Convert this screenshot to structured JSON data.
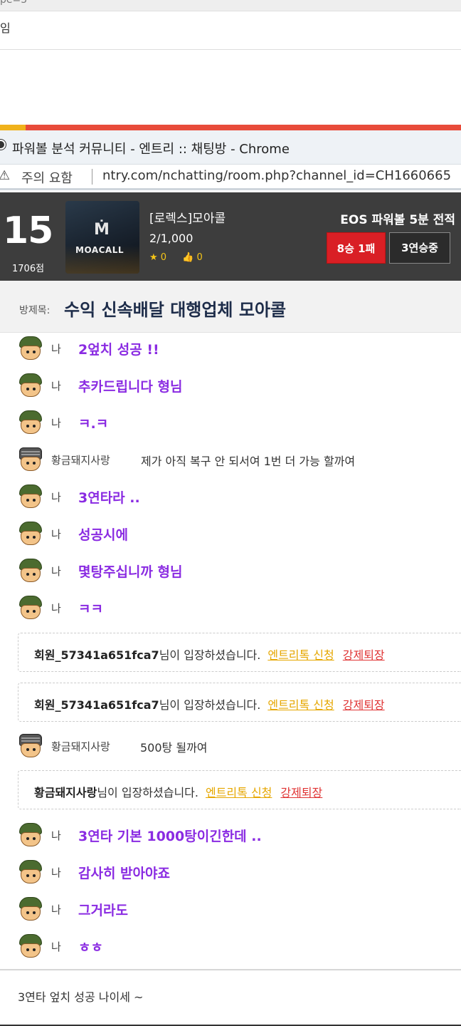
{
  "background_page": {
    "top_text": "pe=5",
    "line_text": "임"
  },
  "window": {
    "title": "파워볼 분석 커뮤니티 - 엔트리 :: 채팅방 - Chrome",
    "warning_label": "주의 요함",
    "url": "ntry.com/nchatting/room.php?channel_id=CH1660665"
  },
  "header": {
    "level": "15",
    "points": "1706점",
    "thumbnail_brand": "MOACALL",
    "room_name": "[로렉스]모아콜",
    "members": "2/1,000",
    "star_count": "0",
    "like_count": "0",
    "record_title": "EOS 파워볼 5분 전적",
    "win_loss": "8승 1패",
    "streak": "3연승중"
  },
  "room": {
    "title_label": "방제목:",
    "title": "수익 신속배달 대행업체 모아콜"
  },
  "messages": [
    {
      "type": "me",
      "nick": "나",
      "text": "2엎치 성공 !!"
    },
    {
      "type": "me",
      "nick": "나",
      "text": "추카드립니다 형님"
    },
    {
      "type": "me",
      "nick": "나",
      "text": "ㅋ.ㅋ"
    },
    {
      "type": "other",
      "nick": "황금돼지사랑",
      "text": "제가 아직 복구 안 되서여 1번 더 가능 할까여"
    },
    {
      "type": "me",
      "nick": "나",
      "text": "3연타라 .."
    },
    {
      "type": "me",
      "nick": "나",
      "text": "성공시에"
    },
    {
      "type": "me",
      "nick": "나",
      "text": "몇탕주십니까 형님"
    },
    {
      "type": "me",
      "nick": "나",
      "text": "ㅋㅋ"
    },
    {
      "type": "system",
      "user": "회원_57341a651fca7",
      "text": "님이 입장하셨습니다.",
      "link1": "엔트리톡 신청",
      "link2": "강제퇴장"
    },
    {
      "type": "system",
      "user": "회원_57341a651fca7",
      "text": "님이 입장하셨습니다.",
      "link1": "엔트리톡 신청",
      "link2": "강제퇴장"
    },
    {
      "type": "other",
      "nick": "황금돼지사랑",
      "text": "500탕 될까여"
    },
    {
      "type": "system",
      "user": "황금돼지사랑",
      "text": "님이 입장하셨습니다.",
      "link1": "엔트리톡 신청",
      "link2": "강제퇴장"
    },
    {
      "type": "me",
      "nick": "나",
      "text": "3연타 기본 1000탕이긴한데 .."
    },
    {
      "type": "me",
      "nick": "나",
      "text": "감사히 받아야죠"
    },
    {
      "type": "me",
      "nick": "나",
      "text": "그거라도"
    },
    {
      "type": "me",
      "nick": "나",
      "text": "ㅎㅎ"
    }
  ],
  "input": {
    "value": "3연타 엎치 성공 나이세 ~"
  },
  "colors": {
    "accent_bar": "#e84b3a",
    "header_bg": "#3d3d3d",
    "win_badge": "#d91f25",
    "my_message": "#8a2be2",
    "link_yellow": "#e6a700",
    "link_red": "#e03333"
  }
}
